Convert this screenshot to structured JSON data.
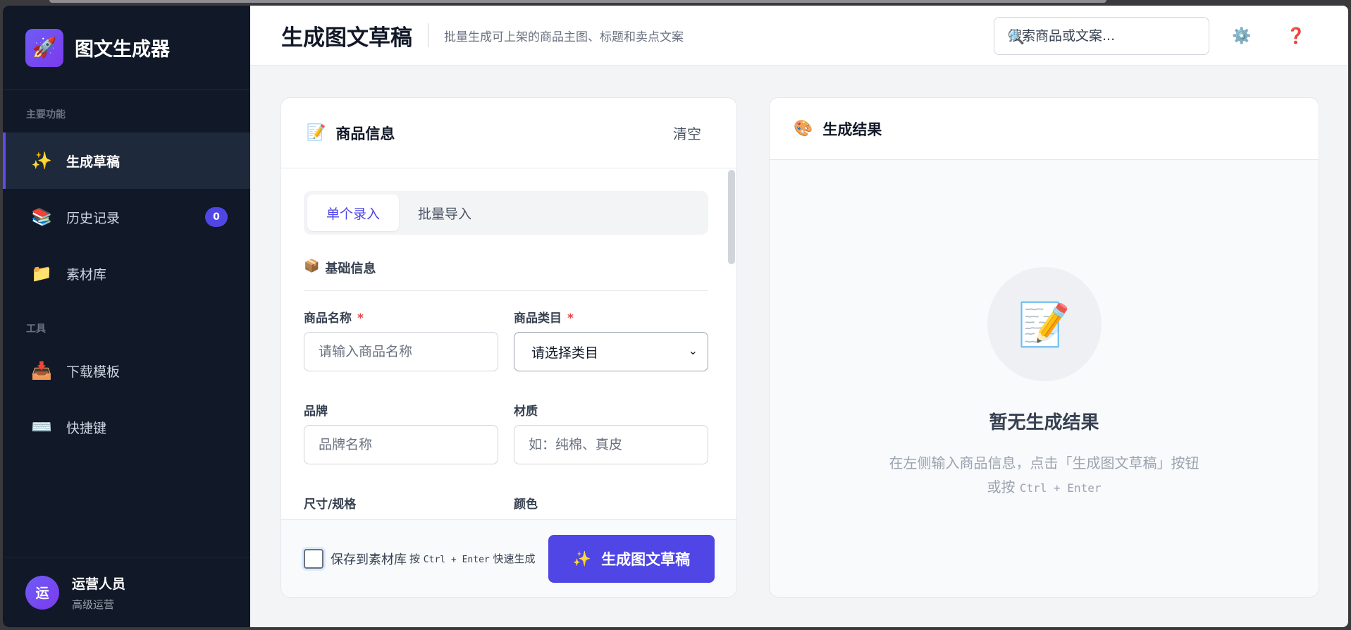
{
  "app": {
    "name": "图文生成器",
    "logo_icon": "rocket-icon"
  },
  "sidebar": {
    "section_main": "主要功能",
    "section_tools": "工具",
    "items": [
      {
        "label": "生成草稿",
        "icon": "sparkles-icon",
        "glyph": "✨",
        "active": true
      },
      {
        "label": "历史记录",
        "icon": "books-icon",
        "glyph": "📚",
        "badge": "0"
      },
      {
        "label": "素材库",
        "icon": "folder-icon",
        "glyph": "📁"
      }
    ],
    "tools": [
      {
        "label": "下载模板",
        "icon": "download-tray-icon",
        "glyph": "📥"
      },
      {
        "label": "快捷键",
        "icon": "keyboard-icon",
        "glyph": "⌨️"
      }
    ],
    "user": {
      "avatar_text": "运",
      "name": "运营人员",
      "role": "高级运营"
    }
  },
  "header": {
    "title": "生成图文草稿",
    "subtitle": "批量生成可上架的商品主图、标题和卖点文案",
    "search_placeholder": "搜索商品或文案...",
    "settings_icon": "gear-icon",
    "help_icon": "question-icon"
  },
  "form_card": {
    "title": "商品信息",
    "clear_label": "清空",
    "tabs": [
      "单个录入",
      "批量导入"
    ],
    "group_title": "基础信息",
    "fields": {
      "name_label": "商品名称",
      "name_placeholder": "请输入商品名称",
      "category_label": "商品类目",
      "category_value": "请选择类目",
      "brand_label": "品牌",
      "brand_placeholder": "品牌名称",
      "material_label": "材质",
      "material_placeholder": "如：纯棉、真皮",
      "size_label": "尺寸/规格",
      "color_label": "颜色",
      "required_mark": "*"
    },
    "footer": {
      "save_label": "保存到素材库",
      "hint_prefix": "按",
      "hint_keys": "Ctrl + Enter",
      "hint_suffix": "快速生成",
      "generate_label": "生成图文草稿"
    }
  },
  "result_card": {
    "title": "生成结果",
    "empty_title": "暂无生成结果",
    "empty_desc_line1": "在左侧输入商品信息，点击「生成图文草稿」按钮",
    "empty_desc_line2_prefix": "或按",
    "empty_desc_keys": "Ctrl + Enter"
  },
  "colors": {
    "sidebar_bg": "#111827",
    "accent": "#4f46e5",
    "required": "#ef4444"
  }
}
